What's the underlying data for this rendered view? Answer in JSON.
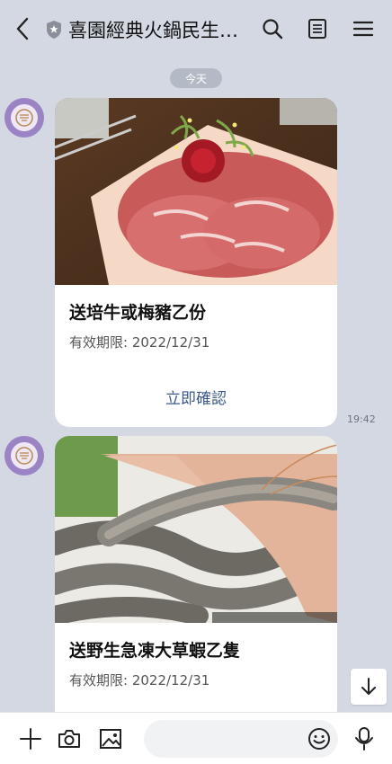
{
  "header": {
    "title": "喜園經典火鍋民生…",
    "icons": [
      "back-icon",
      "shield-icon",
      "search-icon",
      "notes-icon",
      "menu-icon"
    ]
  },
  "chat": {
    "date_label": "今天",
    "messages": [
      {
        "title": "送培牛或梅豬乙份",
        "validity": "有效期限: 2022/12/31",
        "button_label": "立即確認",
        "time": "19:42"
      },
      {
        "title": "送野生急凍大草蝦乙隻",
        "validity": "有效期限: 2022/12/31"
      }
    ]
  },
  "input": {
    "placeholder": "",
    "value": ""
  },
  "colors": {
    "background": "#d3d8e3",
    "button_text": "#3c5a86",
    "avatar": "#9b84c4"
  }
}
